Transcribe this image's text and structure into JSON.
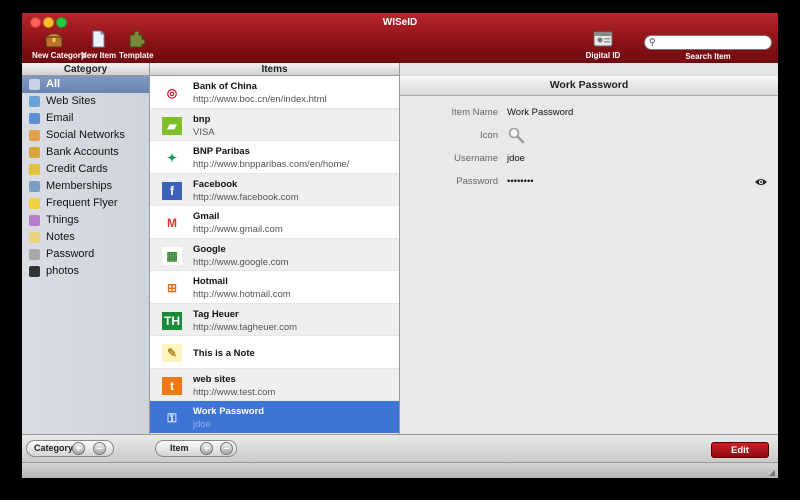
{
  "window": {
    "title": "WISeID"
  },
  "toolbar": {
    "new_category": "New Category",
    "new_item": "New Item",
    "template": "Template",
    "digital_id": "Digital ID",
    "search_label": "Search Item",
    "search_value": ""
  },
  "headers": {
    "category": "Category",
    "items": "Items"
  },
  "categories": [
    {
      "label": "All",
      "icon": "all-icon",
      "color": "#c9d3e6",
      "selected": true
    },
    {
      "label": "Web Sites",
      "icon": "web-sites-icon",
      "color": "#6aa3d8"
    },
    {
      "label": "Email",
      "icon": "email-icon",
      "color": "#5b8fd6"
    },
    {
      "label": "Social Networks",
      "icon": "social-networks-icon",
      "color": "#e0a34a"
    },
    {
      "label": "Bank Accounts",
      "icon": "bank-accounts-icon",
      "color": "#d8a93a"
    },
    {
      "label": "Credit Cards",
      "icon": "credit-cards-icon",
      "color": "#e3c23a"
    },
    {
      "label": "Memberships",
      "icon": "memberships-icon",
      "color": "#7aa0c8"
    },
    {
      "label": "Frequent Flyer",
      "icon": "frequent-flyer-icon",
      "color": "#f0d040"
    },
    {
      "label": "Things",
      "icon": "things-icon",
      "color": "#b87cc8"
    },
    {
      "label": "Notes",
      "icon": "notes-icon",
      "color": "#e8d27a"
    },
    {
      "label": "Password",
      "icon": "password-icon",
      "color": "#a8a8a8"
    },
    {
      "label": "photos",
      "icon": "photos-icon",
      "color": "#333333"
    }
  ],
  "items": [
    {
      "title": "Bank of China",
      "sub": "http://www.boc.cn/en/index.html",
      "icon": "bank-of-china-icon",
      "glyph": "◎",
      "color": "#d0102a",
      "bg": "#ffffff"
    },
    {
      "title": "bnp",
      "sub": "VISA",
      "icon": "credit-card-icon",
      "glyph": "▰",
      "color": "#ffffff",
      "bg": "#7fbf2a"
    },
    {
      "title": "BNP Paribas",
      "sub": "http://www.bnpparibas.com/en/home/",
      "icon": "bnp-paribas-icon",
      "glyph": "✦",
      "color": "#1a9a5a",
      "bg": "#ffffff"
    },
    {
      "title": "Facebook",
      "sub": "http://www.facebook.com",
      "icon": "facebook-icon",
      "glyph": "f",
      "color": "#ffffff",
      "bg": "#3b62b8"
    },
    {
      "title": "Gmail",
      "sub": "http://www.gmail.com",
      "icon": "gmail-icon",
      "glyph": "M",
      "color": "#d33a2c",
      "bg": "#ffffff"
    },
    {
      "title": "Google",
      "sub": "http://www.google.com",
      "icon": "google-icon",
      "glyph": "▦",
      "color": "#3a8a3a",
      "bg": "#ffffff"
    },
    {
      "title": "Hotmail",
      "sub": "http://www.hotmail.com",
      "icon": "windows-icon",
      "glyph": "⊞",
      "color": "#e07020",
      "bg": "#ffffff"
    },
    {
      "title": "Tag Heuer",
      "sub": "http://www.tagheuer.com",
      "icon": "tag-heuer-icon",
      "glyph": "TH",
      "color": "#ffffff",
      "bg": "#1a8a3a"
    },
    {
      "title": "This is a Note",
      "sub": "",
      "icon": "note-icon",
      "glyph": "✎",
      "color": "#b08a20",
      "bg": "#fff4c0"
    },
    {
      "title": "web sites",
      "sub": "http://www.test.com",
      "icon": "web-sites-item-icon",
      "glyph": "t",
      "color": "#ffffff",
      "bg": "#f07a10"
    },
    {
      "title": "Work Password",
      "sub": "jdoe",
      "icon": "key-icon",
      "glyph": "⚿",
      "color": "#dfe8ff",
      "bg": "transparent",
      "selected": true
    }
  ],
  "detail": {
    "title": "Work Password",
    "fields": [
      {
        "label": "Item Name",
        "value": "Work Password"
      },
      {
        "label": "Icon",
        "value": ""
      },
      {
        "label": "Username",
        "value": "jdoe"
      },
      {
        "label": "Password",
        "value": "••••••••"
      }
    ]
  },
  "bottom": {
    "category_label": "Category",
    "item_label": "Item",
    "edit_label": "Edit"
  }
}
